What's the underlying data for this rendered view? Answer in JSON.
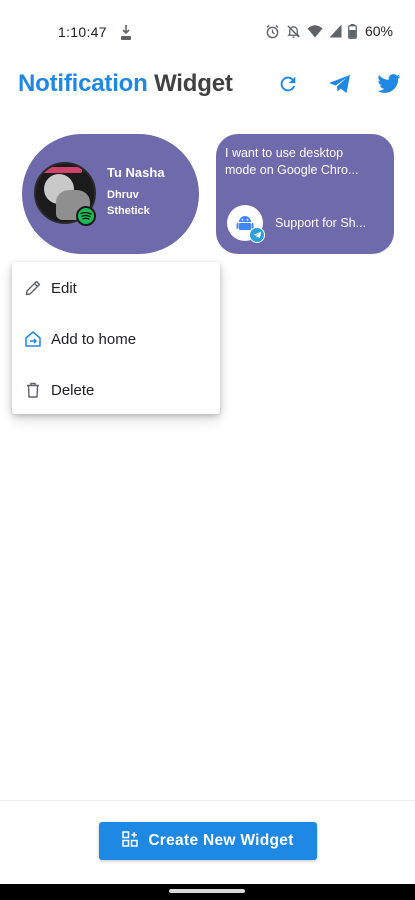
{
  "status_bar": {
    "time": "1:10:47",
    "battery": "60%",
    "icons": [
      "data-saver-icon",
      "alarm-icon",
      "notifications-off-icon",
      "wifi-icon",
      "signal-icon",
      "battery-icon"
    ]
  },
  "app_bar": {
    "title_part1": "Notification",
    "title_part2": "Widget",
    "accent_color": "#1e88e5",
    "actions": [
      "refresh-icon",
      "telegram-icon",
      "twitter-icon"
    ]
  },
  "widgets": {
    "music": {
      "title": "Tu Nasha",
      "artist": "Dhruv Sthetick",
      "background": "#6e6aab",
      "source_icon": "spotify-icon"
    },
    "chat": {
      "message_line1": "I want to use desktop",
      "message_line2": "mode on Google Chro...",
      "sender": "Support for Sh...",
      "background": "#6e6aab",
      "avatar_icon": "android-icon",
      "source_icon": "telegram-icon"
    }
  },
  "context_menu": {
    "items": [
      {
        "label": "Edit",
        "icon": "pencil-icon"
      },
      {
        "label": "Add to home",
        "icon": "add-to-home-icon"
      },
      {
        "label": "Delete",
        "icon": "trash-icon"
      }
    ]
  },
  "create_button": {
    "label": "Create New Widget",
    "icon": "widget-add-icon",
    "color": "#1e88e5"
  }
}
